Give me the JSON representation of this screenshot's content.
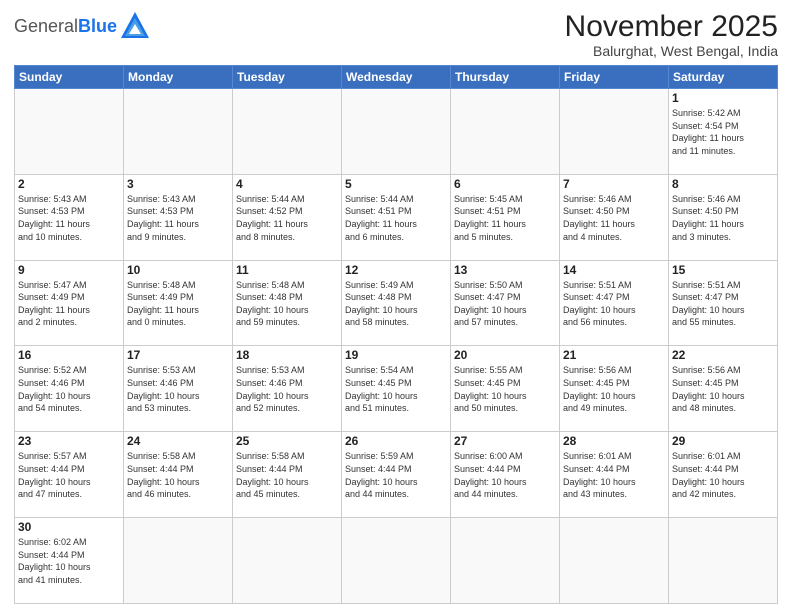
{
  "header": {
    "logo_general": "General",
    "logo_blue": "Blue",
    "title": "November 2025",
    "subtitle": "Balurghat, West Bengal, India"
  },
  "weekdays": [
    "Sunday",
    "Monday",
    "Tuesday",
    "Wednesday",
    "Thursday",
    "Friday",
    "Saturday"
  ],
  "weeks": [
    [
      {
        "day": "",
        "info": ""
      },
      {
        "day": "",
        "info": ""
      },
      {
        "day": "",
        "info": ""
      },
      {
        "day": "",
        "info": ""
      },
      {
        "day": "",
        "info": ""
      },
      {
        "day": "",
        "info": ""
      },
      {
        "day": "1",
        "info": "Sunrise: 5:42 AM\nSunset: 4:54 PM\nDaylight: 11 hours\nand 11 minutes."
      }
    ],
    [
      {
        "day": "2",
        "info": "Sunrise: 5:43 AM\nSunset: 4:53 PM\nDaylight: 11 hours\nand 10 minutes."
      },
      {
        "day": "3",
        "info": "Sunrise: 5:43 AM\nSunset: 4:53 PM\nDaylight: 11 hours\nand 9 minutes."
      },
      {
        "day": "4",
        "info": "Sunrise: 5:44 AM\nSunset: 4:52 PM\nDaylight: 11 hours\nand 8 minutes."
      },
      {
        "day": "5",
        "info": "Sunrise: 5:44 AM\nSunset: 4:51 PM\nDaylight: 11 hours\nand 6 minutes."
      },
      {
        "day": "6",
        "info": "Sunrise: 5:45 AM\nSunset: 4:51 PM\nDaylight: 11 hours\nand 5 minutes."
      },
      {
        "day": "7",
        "info": "Sunrise: 5:46 AM\nSunset: 4:50 PM\nDaylight: 11 hours\nand 4 minutes."
      },
      {
        "day": "8",
        "info": "Sunrise: 5:46 AM\nSunset: 4:50 PM\nDaylight: 11 hours\nand 3 minutes."
      }
    ],
    [
      {
        "day": "9",
        "info": "Sunrise: 5:47 AM\nSunset: 4:49 PM\nDaylight: 11 hours\nand 2 minutes."
      },
      {
        "day": "10",
        "info": "Sunrise: 5:48 AM\nSunset: 4:49 PM\nDaylight: 11 hours\nand 0 minutes."
      },
      {
        "day": "11",
        "info": "Sunrise: 5:48 AM\nSunset: 4:48 PM\nDaylight: 10 hours\nand 59 minutes."
      },
      {
        "day": "12",
        "info": "Sunrise: 5:49 AM\nSunset: 4:48 PM\nDaylight: 10 hours\nand 58 minutes."
      },
      {
        "day": "13",
        "info": "Sunrise: 5:50 AM\nSunset: 4:47 PM\nDaylight: 10 hours\nand 57 minutes."
      },
      {
        "day": "14",
        "info": "Sunrise: 5:51 AM\nSunset: 4:47 PM\nDaylight: 10 hours\nand 56 minutes."
      },
      {
        "day": "15",
        "info": "Sunrise: 5:51 AM\nSunset: 4:47 PM\nDaylight: 10 hours\nand 55 minutes."
      }
    ],
    [
      {
        "day": "16",
        "info": "Sunrise: 5:52 AM\nSunset: 4:46 PM\nDaylight: 10 hours\nand 54 minutes."
      },
      {
        "day": "17",
        "info": "Sunrise: 5:53 AM\nSunset: 4:46 PM\nDaylight: 10 hours\nand 53 minutes."
      },
      {
        "day": "18",
        "info": "Sunrise: 5:53 AM\nSunset: 4:46 PM\nDaylight: 10 hours\nand 52 minutes."
      },
      {
        "day": "19",
        "info": "Sunrise: 5:54 AM\nSunset: 4:45 PM\nDaylight: 10 hours\nand 51 minutes."
      },
      {
        "day": "20",
        "info": "Sunrise: 5:55 AM\nSunset: 4:45 PM\nDaylight: 10 hours\nand 50 minutes."
      },
      {
        "day": "21",
        "info": "Sunrise: 5:56 AM\nSunset: 4:45 PM\nDaylight: 10 hours\nand 49 minutes."
      },
      {
        "day": "22",
        "info": "Sunrise: 5:56 AM\nSunset: 4:45 PM\nDaylight: 10 hours\nand 48 minutes."
      }
    ],
    [
      {
        "day": "23",
        "info": "Sunrise: 5:57 AM\nSunset: 4:44 PM\nDaylight: 10 hours\nand 47 minutes."
      },
      {
        "day": "24",
        "info": "Sunrise: 5:58 AM\nSunset: 4:44 PM\nDaylight: 10 hours\nand 46 minutes."
      },
      {
        "day": "25",
        "info": "Sunrise: 5:58 AM\nSunset: 4:44 PM\nDaylight: 10 hours\nand 45 minutes."
      },
      {
        "day": "26",
        "info": "Sunrise: 5:59 AM\nSunset: 4:44 PM\nDaylight: 10 hours\nand 44 minutes."
      },
      {
        "day": "27",
        "info": "Sunrise: 6:00 AM\nSunset: 4:44 PM\nDaylight: 10 hours\nand 44 minutes."
      },
      {
        "day": "28",
        "info": "Sunrise: 6:01 AM\nSunset: 4:44 PM\nDaylight: 10 hours\nand 43 minutes."
      },
      {
        "day": "29",
        "info": "Sunrise: 6:01 AM\nSunset: 4:44 PM\nDaylight: 10 hours\nand 42 minutes."
      }
    ],
    [
      {
        "day": "30",
        "info": "Sunrise: 6:02 AM\nSunset: 4:44 PM\nDaylight: 10 hours\nand 41 minutes."
      },
      {
        "day": "",
        "info": ""
      },
      {
        "day": "",
        "info": ""
      },
      {
        "day": "",
        "info": ""
      },
      {
        "day": "",
        "info": ""
      },
      {
        "day": "",
        "info": ""
      },
      {
        "day": "",
        "info": ""
      }
    ]
  ]
}
